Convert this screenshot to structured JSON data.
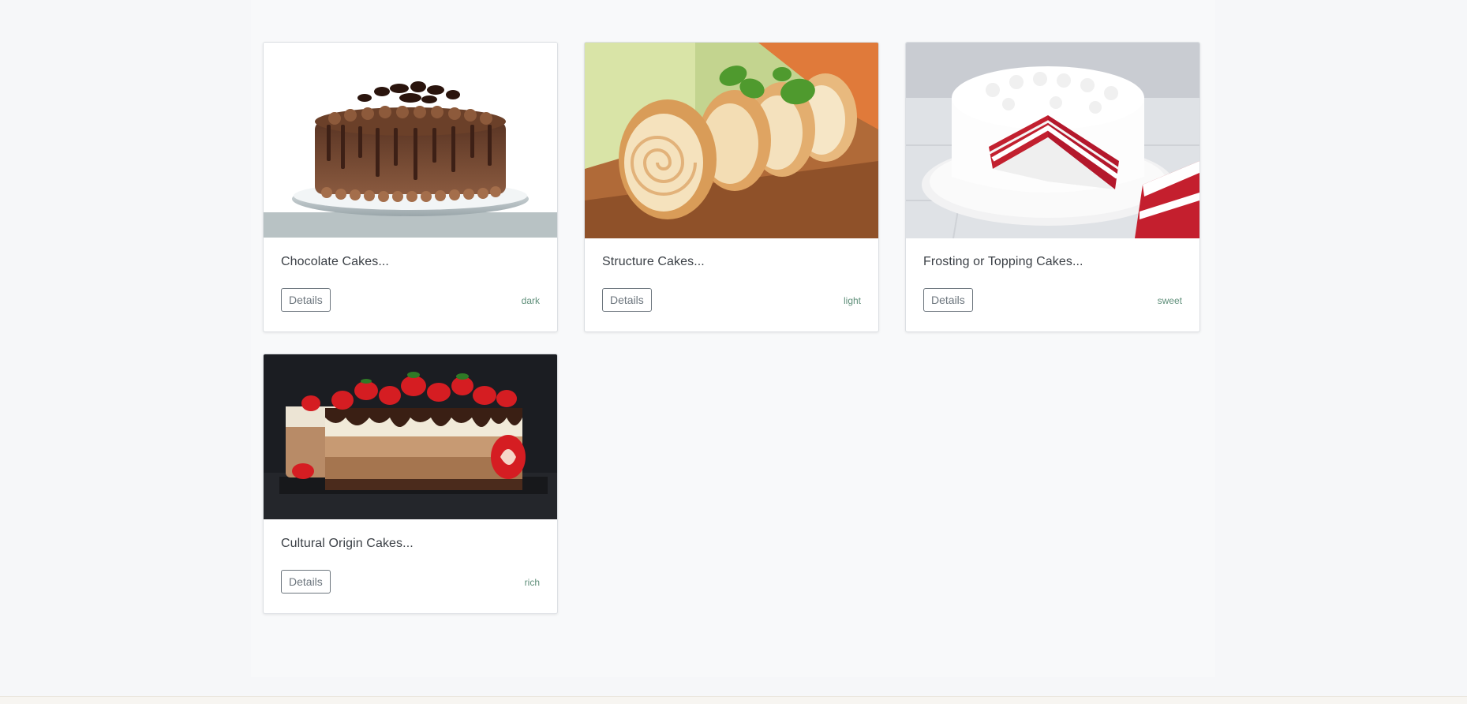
{
  "cards": [
    {
      "title": "Chocolate Cakes...",
      "button": "Details",
      "tag": "dark",
      "image": "chocolate-cake-image"
    },
    {
      "title": "Structure Cakes...",
      "button": "Details",
      "tag": "light",
      "image": "swiss-roll-image"
    },
    {
      "title": "Frosting or Topping Cakes...",
      "button": "Details",
      "tag": "sweet",
      "image": "red-velvet-cake-image"
    },
    {
      "title": "Cultural Origin Cakes...",
      "button": "Details",
      "tag": "rich",
      "image": "strawberry-mousse-cake-image"
    }
  ],
  "colors": {
    "page_background": "#f6f7f9",
    "card_border": "#dcdfe3",
    "button_border": "#6c757d",
    "tag_text": "#5f8f7a"
  }
}
